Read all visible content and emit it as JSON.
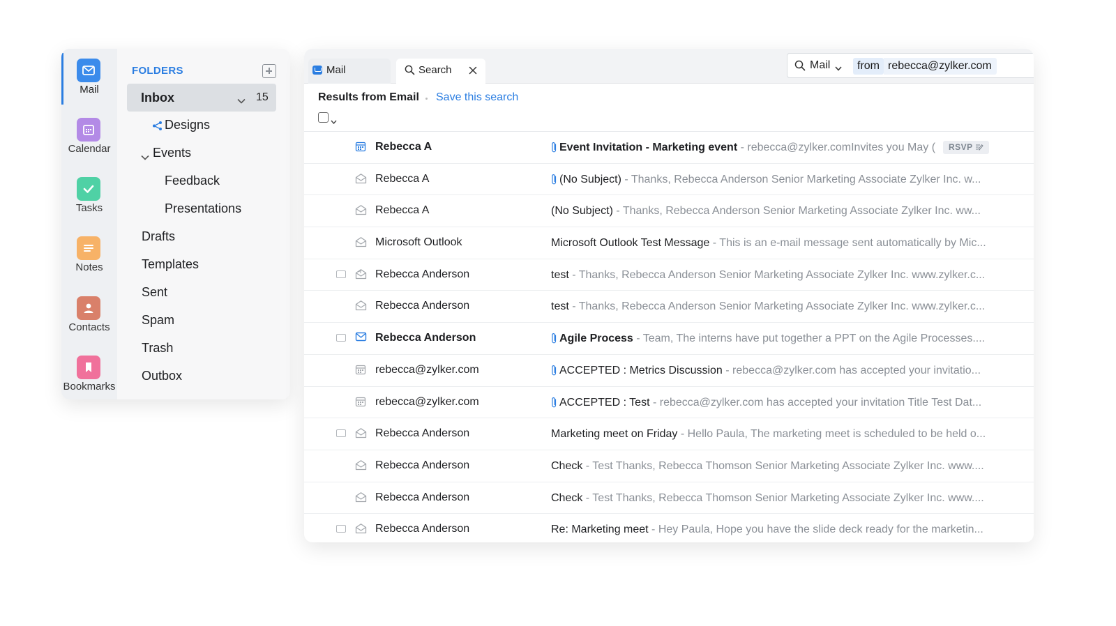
{
  "rail": {
    "items": [
      {
        "label": "Mail",
        "icon": "mail-icon",
        "color": "#3b8beb",
        "active": true
      },
      {
        "label": "Calendar",
        "icon": "calendar-icon",
        "color": "#b38ae6"
      },
      {
        "label": "Tasks",
        "icon": "check-icon",
        "color": "#4fd1a5"
      },
      {
        "label": "Notes",
        "icon": "notes-icon",
        "color": "#f7b267"
      },
      {
        "label": "Contacts",
        "icon": "contact-icon",
        "color": "#d9806a"
      },
      {
        "label": "Bookmarks",
        "icon": "bookmark-icon",
        "color": "#f0719b"
      }
    ]
  },
  "folders": {
    "title": "FOLDERS",
    "inbox": {
      "label": "Inbox",
      "count": "15"
    },
    "items": [
      {
        "label": "Designs",
        "indent": 1,
        "icon": "share-icon"
      },
      {
        "label": "Events",
        "indent": 1,
        "icon": "chevron-down-icon"
      },
      {
        "label": "Feedback",
        "indent": 2
      },
      {
        "label": "Presentations",
        "indent": 2
      },
      {
        "label": "Drafts",
        "indent": 0
      },
      {
        "label": "Templates",
        "indent": 0
      },
      {
        "label": "Sent",
        "indent": 0
      },
      {
        "label": "Spam",
        "indent": 0
      },
      {
        "label": "Trash",
        "indent": 0
      },
      {
        "label": "Outbox",
        "indent": 0
      }
    ]
  },
  "tabs": {
    "mail": "Mail",
    "search": "Search"
  },
  "search": {
    "scope": "Mail",
    "token_key": "from",
    "token_value": "rebecca@zylker.com"
  },
  "results": {
    "title": "Results from Email",
    "save_label": "Save this search"
  },
  "emails": [
    {
      "sender": "Rebecca A",
      "subject": "Event Invitation - Marketing event",
      "preview": " - rebecca@zylker.comInvites you May (",
      "unread": true,
      "icon": "calendar",
      "clip": true,
      "thread": false,
      "rsvp": "RSVP"
    },
    {
      "sender": "Rebecca A",
      "subject": "(No Subject)",
      "preview": " - Thanks, Rebecca Anderson Senior Marketing Associate Zylker Inc. w...",
      "unread": false,
      "icon": "envelope-open",
      "clip": true,
      "thread": false
    },
    {
      "sender": "Rebecca A",
      "subject": "(No Subject)",
      "preview": " - Thanks, Rebecca Anderson Senior Marketing Associate Zylker Inc. ww...",
      "unread": false,
      "icon": "envelope-open",
      "clip": false,
      "thread": false
    },
    {
      "sender": "Microsoft Outlook",
      "subject": "Microsoft Outlook Test Message",
      "preview": " - This is an e-mail message sent automatically by Mic...",
      "unread": false,
      "icon": "envelope-open",
      "clip": false,
      "thread": false
    },
    {
      "sender": "Rebecca Anderson",
      "subject": "test",
      "preview": " - Thanks, Rebecca Anderson Senior Marketing Associate Zylker Inc. www.zylker.c...",
      "unread": false,
      "icon": "envelope-replied",
      "clip": false,
      "thread": true
    },
    {
      "sender": "Rebecca Anderson",
      "subject": "test",
      "preview": " - Thanks, Rebecca Anderson Senior Marketing Associate Zylker Inc. www.zylker.c...",
      "unread": false,
      "icon": "envelope-open",
      "clip": false,
      "thread": false
    },
    {
      "sender": "Rebecca Anderson",
      "subject": "Agile Process",
      "preview": " - Team, The interns have put together a PPT on the Agile Processes....",
      "unread": true,
      "icon": "envelope-closed",
      "clip": true,
      "thread": true
    },
    {
      "sender": "rebecca@zylker.com",
      "subject": "ACCEPTED : Metrics Discussion",
      "preview": " - rebecca@zylker.com has accepted your invitatio...",
      "unread": false,
      "icon": "calendar-grey",
      "clip": true,
      "thread": false
    },
    {
      "sender": "rebecca@zylker.com",
      "subject": "ACCEPTED : Test",
      "preview": " - rebecca@zylker.com has accepted your invitation Title Test Dat...",
      "unread": false,
      "icon": "calendar-grey",
      "clip": true,
      "thread": false
    },
    {
      "sender": "Rebecca Anderson",
      "subject": "Marketing meet on Friday",
      "preview": " - Hello Paula, The marketing meet is scheduled to be held o...",
      "unread": false,
      "icon": "envelope-open",
      "clip": false,
      "thread": true
    },
    {
      "sender": "Rebecca Anderson",
      "subject": "Check",
      "preview": " - Test Thanks, Rebecca Thomson Senior Marketing Associate Zylker Inc. www....",
      "unread": false,
      "icon": "envelope-open",
      "clip": false,
      "thread": false
    },
    {
      "sender": "Rebecca Anderson",
      "subject": "Check",
      "preview": " - Test Thanks, Rebecca Thomson Senior Marketing Associate Zylker Inc. www....",
      "unread": false,
      "icon": "envelope-open",
      "clip": false,
      "thread": false
    },
    {
      "sender": "Rebecca Anderson",
      "subject": "Re: Marketing meet",
      "preview": " - Hey Paula, Hope you have the slide deck ready for the marketin...",
      "unread": false,
      "icon": "envelope-open",
      "clip": false,
      "thread": true
    }
  ],
  "colors": {
    "accent": "#2a7de1",
    "muted": "#8a8f96"
  }
}
